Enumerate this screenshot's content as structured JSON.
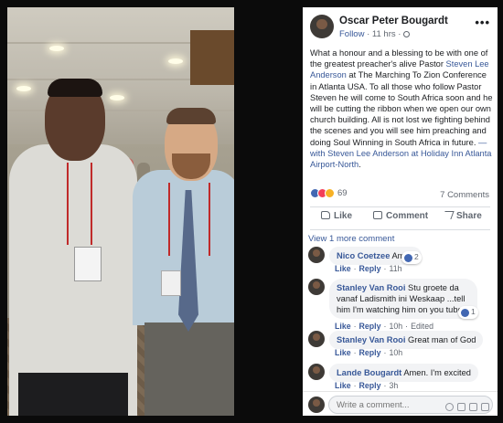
{
  "post": {
    "author": "Oscar Peter Bougardt",
    "follow_label": "Follow",
    "time": "11 hrs",
    "more_label": "•••",
    "text_1": "What a honour and a blessing to be with one of the greatest preacher's alive Pastor ",
    "link_1": "Steven Lee Anderson",
    "text_2": " at The Marching To Zion Conference in Atlanta USA. To all those who follow Pastor Steven he will come to South Africa soon and he will be cutting the ribbon when we open our own church building. All is not lost we fighting behind the scenes and you will see him preaching and doing Soul Winning in South Africa in future.",
    "with_label": " — with ",
    "link_2": "Steven Lee Anderson",
    "at_label": " at ",
    "link_3": "Holiday Inn Atlanta Airport-North",
    "text_end": ".",
    "reaction_count": "69",
    "comment_count": "7 Comments"
  },
  "actions": {
    "like": "Like",
    "comment": "Comment",
    "share": "Share"
  },
  "view_more": "View 1 more comment",
  "comments": [
    {
      "name": "Nico Coetzee",
      "text": "Amen",
      "like_label": "Like",
      "reply_label": "Reply",
      "time": "11h",
      "likes": "2"
    },
    {
      "name": "Stanley Van Rooi",
      "text": "Stu groete da vanaf Ladismith ini Weskaap ...tell him I'm watching him on you tube",
      "like_label": "Like",
      "reply_label": "Reply",
      "time": "10h",
      "edited": "Edited",
      "likes": "1"
    },
    {
      "name": "Stanley Van Rooi",
      "text": "Great man of God",
      "like_label": "Like",
      "reply_label": "Reply",
      "time": "10h"
    },
    {
      "name": "Lande Bougardt",
      "text": "Amen. I'm excited",
      "like_label": "Like",
      "reply_label": "Reply",
      "time": "3h"
    }
  ],
  "composer": {
    "placeholder": "Write a comment..."
  },
  "colors": {
    "link": "#385898",
    "like_blue": "#4267b2",
    "love_red": "#f33e58",
    "wow_yellow": "#f7b125",
    "backdrop": "#0b0b0b"
  }
}
